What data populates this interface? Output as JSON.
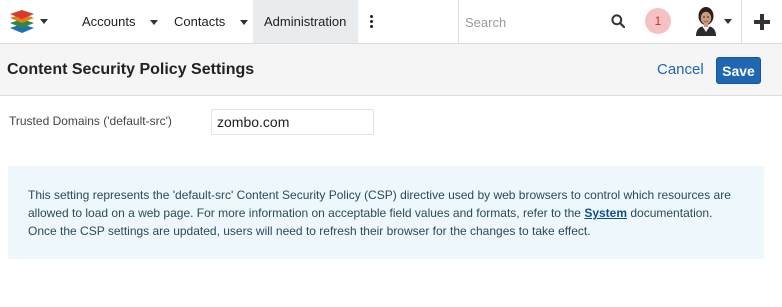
{
  "nav": {
    "tabs": [
      {
        "label": "Accounts"
      },
      {
        "label": "Contacts"
      },
      {
        "label": "Administration"
      }
    ],
    "search_placeholder": "Search",
    "notification_count": "1",
    "icons": [
      "logo-icon",
      "more-vertical-icon",
      "search-icon",
      "avatar",
      "plus-icon"
    ]
  },
  "header": {
    "title": "Content Security Policy Settings",
    "cancel_label": "Cancel",
    "save_label": "Save"
  },
  "form": {
    "trusted_domains_label": "Trusted Domains ('default-src')",
    "trusted_domains_value": "zombo.com"
  },
  "info": {
    "text_before_link": "This setting represents the 'default-src' Content Security Policy (CSP) directive used by web browsers to control which resources are allowed to load on a web page. For more information on acceptable field values and formats, refer to the ",
    "link_text": "System",
    "text_after_link": " documentation. Once the CSP settings are updated, users will need to refresh their browser for the changes to take effect."
  },
  "colors": {
    "primary": "#1f67b2",
    "link": "#2066b0",
    "info_background": "#eef7fb",
    "badge_background": "#f6c1c1"
  }
}
